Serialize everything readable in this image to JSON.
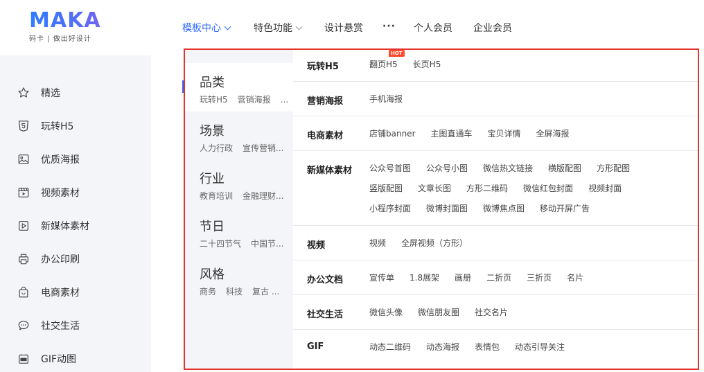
{
  "logo": {
    "main": "MAKA",
    "sub": "码卡 | 做出好设计"
  },
  "nav": [
    {
      "label": "模板中心",
      "active": true,
      "chevron": true
    },
    {
      "label": "特色功能",
      "chevron": true
    },
    {
      "label": "设计悬赏"
    },
    {
      "label": "···"
    },
    {
      "label": "个人会员"
    },
    {
      "label": "企业会员"
    }
  ],
  "sidebar": {
    "items": [
      {
        "label": "精选",
        "icon": "star-icon"
      },
      {
        "label": "玩转H5",
        "icon": "h5-icon"
      },
      {
        "label": "优质海报",
        "icon": "image-icon"
      },
      {
        "label": "视频素材",
        "icon": "film-icon"
      },
      {
        "label": "新媒体素材",
        "icon": "play-icon"
      },
      {
        "label": "办公印刷",
        "icon": "printer-icon"
      },
      {
        "label": "电商素材",
        "icon": "shopping-bag-icon"
      },
      {
        "label": "社交生活",
        "icon": "chat-icon"
      },
      {
        "label": "GIF动图",
        "icon": "gif-icon"
      }
    ]
  },
  "dropdown": {
    "categories": [
      {
        "title": "品类",
        "subs": [
          "玩转H5",
          "营销海报",
          "..."
        ],
        "active": true
      },
      {
        "title": "场景",
        "subs": [
          "人力行政",
          "宣传营销..."
        ]
      },
      {
        "title": "行业",
        "subs": [
          "教育培训",
          "金融理财..."
        ]
      },
      {
        "title": "节日",
        "subs": [
          "二十四节气",
          "中国节..."
        ]
      },
      {
        "title": "风格",
        "subs": [
          "商务",
          "科技",
          "复古 ..."
        ]
      }
    ],
    "hot_badge": "HOT",
    "sections": [
      {
        "title": "玩转H5",
        "rows": [
          [
            "翻页H5",
            "长页H5"
          ]
        ]
      },
      {
        "title": "营销海报",
        "rows": [
          [
            "手机海报"
          ]
        ]
      },
      {
        "title": "电商素材",
        "rows": [
          [
            "店铺banner",
            "主图直通车",
            "宝贝详情",
            "全屏海报"
          ]
        ]
      },
      {
        "title": "新媒体素材",
        "rows": [
          [
            "公众号首图",
            "公众号小图",
            "微信热文链接",
            "横版配图",
            "方形配图"
          ],
          [
            "竖版配图",
            "文章长图",
            "方形二维码",
            "微信红包封面",
            "视频封面"
          ],
          [
            "小程序封面",
            "微博封面图",
            "微博焦点图",
            "移动开屏广告"
          ]
        ]
      },
      {
        "title": "视频",
        "rows": [
          [
            "视频",
            "全屏视频（方形）"
          ]
        ]
      },
      {
        "title": "办公文档",
        "rows": [
          [
            "宣传单",
            "1.8展架",
            "画册",
            "二折页",
            "三折页",
            "名片"
          ]
        ]
      },
      {
        "title": "社交生活",
        "rows": [
          [
            "微信头像",
            "微信朋友圈",
            "社交名片"
          ]
        ]
      },
      {
        "title": "GIF",
        "rows": [
          [
            "动态二维码",
            "动态海报",
            "表情包",
            "动态引导关注"
          ]
        ]
      }
    ]
  },
  "colors": {
    "accent": "#2f6bff",
    "highlight_border": "#e5322d",
    "hot": "#ff4a2e"
  }
}
